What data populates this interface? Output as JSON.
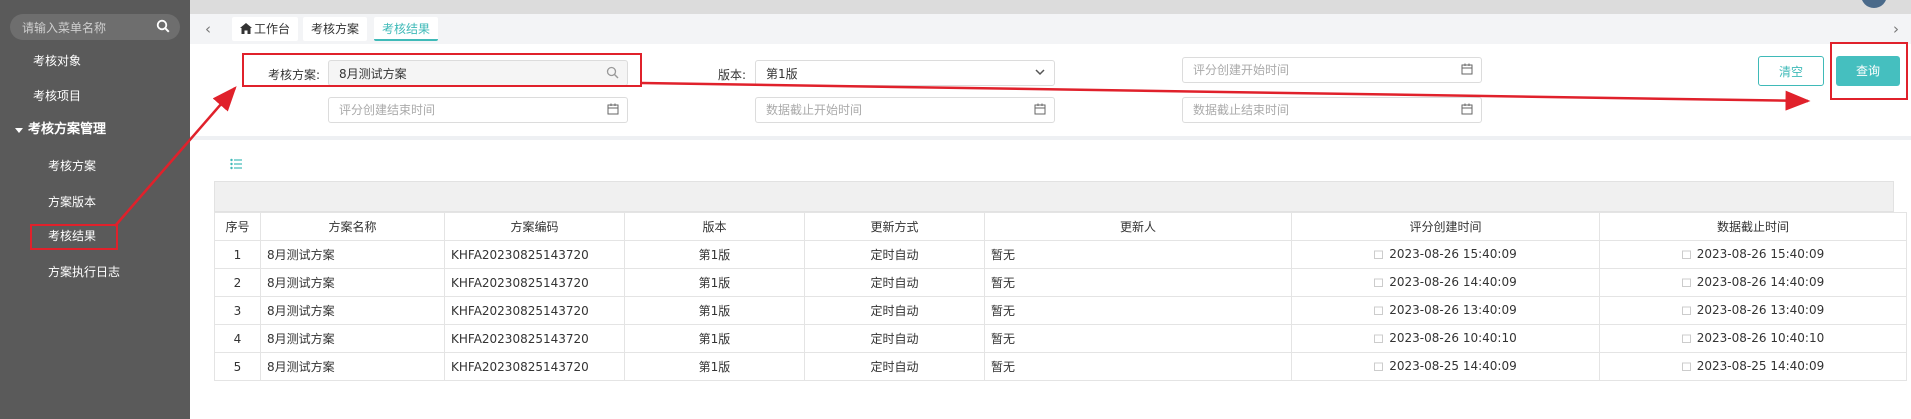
{
  "sidebar": {
    "search_placeholder": "请输入菜单名称",
    "items": [
      {
        "label": "考核对象"
      },
      {
        "label": "考核项目"
      },
      {
        "label": "考核方案管理"
      },
      {
        "label": "考核方案"
      },
      {
        "label": "方案版本"
      },
      {
        "label": "考核结果"
      },
      {
        "label": "方案执行日志"
      }
    ]
  },
  "tabs": [
    {
      "label": "工作台"
    },
    {
      "label": "考核方案"
    },
    {
      "label": "考核结果"
    }
  ],
  "search": {
    "plan_label": "考核方案:",
    "plan_value": "8月测试方案",
    "version_label": "版本:",
    "version_value": "第1版",
    "score_start_placeholder": "评分创建开始时间",
    "score_end_placeholder": "评分创建结束时间",
    "data_start_placeholder": "数据截止开始时间",
    "data_end_placeholder": "数据截止结束时间",
    "clear_label": "清空",
    "query_label": "查询"
  },
  "table": {
    "columns": [
      "序号",
      "方案名称",
      "方案编码",
      "版本",
      "更新方式",
      "更新人",
      "评分创建时间",
      "数据截止时间"
    ],
    "rows": [
      {
        "no": "1",
        "name": "8月测试方案",
        "code": "KHFA20230825143720",
        "version": "第1版",
        "mode": "定时自动",
        "updater": "暂无",
        "created": "2023-08-26 15:40:09",
        "cutoff": "2023-08-26 15:40:09"
      },
      {
        "no": "2",
        "name": "8月测试方案",
        "code": "KHFA20230825143720",
        "version": "第1版",
        "mode": "定时自动",
        "updater": "暂无",
        "created": "2023-08-26 14:40:09",
        "cutoff": "2023-08-26 14:40:09"
      },
      {
        "no": "3",
        "name": "8月测试方案",
        "code": "KHFA20230825143720",
        "version": "第1版",
        "mode": "定时自动",
        "updater": "暂无",
        "created": "2023-08-26 13:40:09",
        "cutoff": "2023-08-26 13:40:09"
      },
      {
        "no": "4",
        "name": "8月测试方案",
        "code": "KHFA20230825143720",
        "version": "第1版",
        "mode": "定时自动",
        "updater": "暂无",
        "created": "2023-08-26 10:40:10",
        "cutoff": "2023-08-26 10:40:10"
      },
      {
        "no": "5",
        "name": "8月测试方案",
        "code": "KHFA20230825143720",
        "version": "第1版",
        "mode": "定时自动",
        "updater": "暂无",
        "created": "2023-08-25 14:40:09",
        "cutoff": "2023-08-25 14:40:09"
      }
    ]
  },
  "colors": {
    "accent": "#3fbab8",
    "annotation": "#e0212b",
    "sidebar": "#5a5a5a"
  }
}
